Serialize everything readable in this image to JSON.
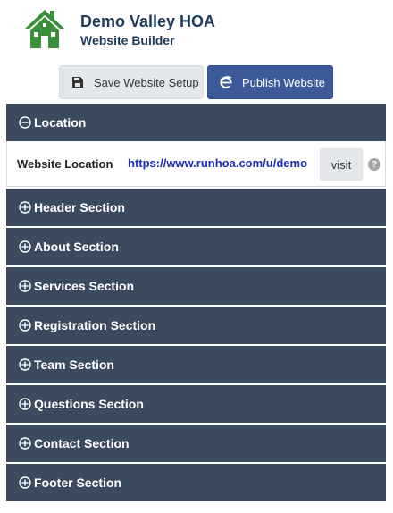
{
  "header": {
    "org_name": "Demo Valley HOA",
    "app_name": "Website Builder",
    "logo_icon": "house-icon",
    "brand_color": "#3a8f3a"
  },
  "toolbar": {
    "save_label": "Save Website Setup",
    "save_icon": "floppy-disk-icon",
    "publish_label": "Publish Website",
    "publish_icon": "browser-e-icon",
    "publish_color": "#3c5a9a"
  },
  "location": {
    "header_label": "Location",
    "state": "expanded",
    "field_label": "Website Location",
    "url": "https://www.runhoa.com/u/demo",
    "visit_label": "visit",
    "help_icon": "?"
  },
  "sections": [
    {
      "label": "Header Section"
    },
    {
      "label": "About Section"
    },
    {
      "label": "Services Section"
    },
    {
      "label": "Registration Section"
    },
    {
      "label": "Team Section"
    },
    {
      "label": "Questions Section"
    },
    {
      "label": "Contact Section"
    },
    {
      "label": "Footer Section"
    }
  ],
  "colors": {
    "section_bg": "#3b4a5e",
    "title": "#1f3b5c"
  }
}
